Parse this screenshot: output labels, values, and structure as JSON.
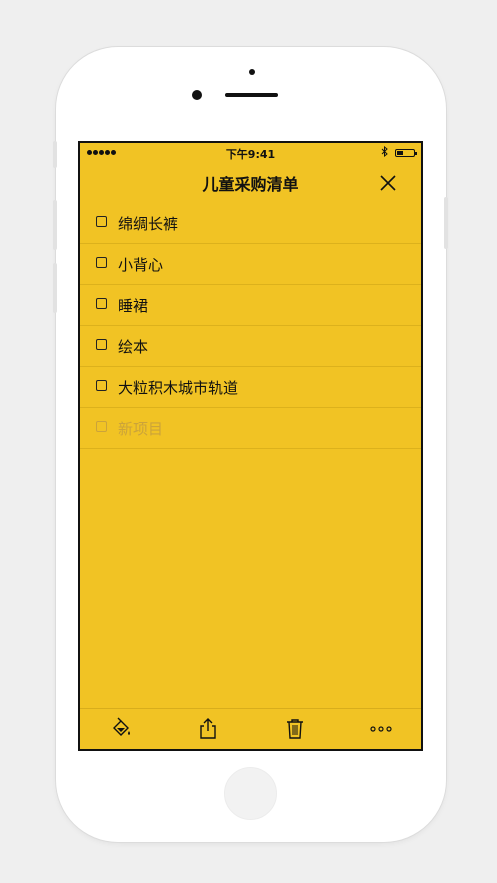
{
  "status_bar": {
    "time": "下午9:41",
    "bluetooth_icon": "bluetooth-icon",
    "battery_icon": "battery-icon",
    "signal_icon": "signal-dots-icon"
  },
  "nav": {
    "title": "儿童采购清单",
    "close_icon": "close-icon"
  },
  "items": [
    {
      "label": "绵绸长裤",
      "checked": false
    },
    {
      "label": "小背心",
      "checked": false
    },
    {
      "label": "睡裙",
      "checked": false
    },
    {
      "label": "绘本",
      "checked": false
    },
    {
      "label": "大粒积木城市轨道",
      "checked": false
    }
  ],
  "new_item": {
    "placeholder": "新项目"
  },
  "toolbar": {
    "icons": [
      "paint-bucket-icon",
      "share-icon",
      "trash-icon",
      "more-icon"
    ]
  },
  "colors": {
    "background": "#f1c324",
    "separator": "#dcb11c",
    "placeholder_text": "#cba33a"
  }
}
